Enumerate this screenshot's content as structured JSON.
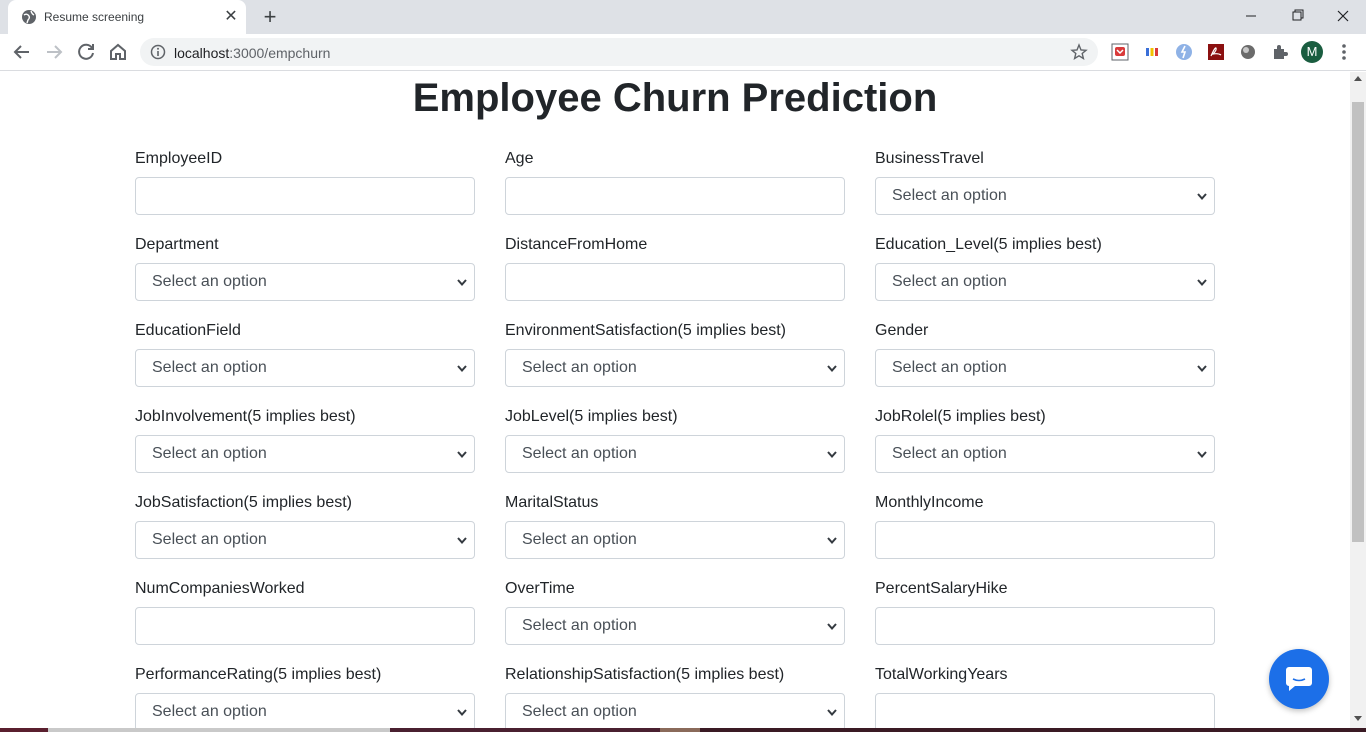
{
  "browser": {
    "tab_title": "Resume screening",
    "url_host": "localhost",
    "url_path": ":3000/empchurn",
    "avatar_letter": "M"
  },
  "page": {
    "title": "Employee Churn Prediction",
    "select_placeholder": "Select an option",
    "fields": [
      {
        "label": "EmployeeID",
        "type": "input"
      },
      {
        "label": "Age",
        "type": "input"
      },
      {
        "label": "BusinessTravel",
        "type": "select"
      },
      {
        "label": "Department",
        "type": "select"
      },
      {
        "label": "DistanceFromHome",
        "type": "input"
      },
      {
        "label": "Education_Level(5 implies best)",
        "type": "select"
      },
      {
        "label": "EducationField",
        "type": "select"
      },
      {
        "label": "EnvironmentSatisfaction(5 implies best)",
        "type": "select"
      },
      {
        "label": "Gender",
        "type": "select"
      },
      {
        "label": "JobInvolvement(5 implies best)",
        "type": "select"
      },
      {
        "label": "JobLevel(5 implies best)",
        "type": "select"
      },
      {
        "label": "JobRolel(5 implies best)",
        "type": "select"
      },
      {
        "label": "JobSatisfaction(5 implies best)",
        "type": "select"
      },
      {
        "label": "MaritalStatus",
        "type": "select"
      },
      {
        "label": "MonthlyIncome",
        "type": "input"
      },
      {
        "label": "NumCompaniesWorked",
        "type": "input"
      },
      {
        "label": "OverTime",
        "type": "select"
      },
      {
        "label": "PercentSalaryHike",
        "type": "input"
      },
      {
        "label": "PerformanceRating(5 implies best)",
        "type": "select"
      },
      {
        "label": "RelationshipSatisfaction(5 implies best)",
        "type": "select"
      },
      {
        "label": "TotalWorkingYears",
        "type": "input"
      }
    ]
  },
  "colors": {
    "chat_button": "#1c6fe8",
    "text": "#212529"
  },
  "icons": [
    "globe-icon",
    "close-icon",
    "plus-icon",
    "minimize-icon",
    "maximize-icon",
    "window-close-icon",
    "back-arrow-icon",
    "forward-arrow-icon",
    "reload-icon",
    "home-icon",
    "info-icon",
    "star-icon",
    "puzzle-icon",
    "chevron-down-icon",
    "chat-icon"
  ]
}
